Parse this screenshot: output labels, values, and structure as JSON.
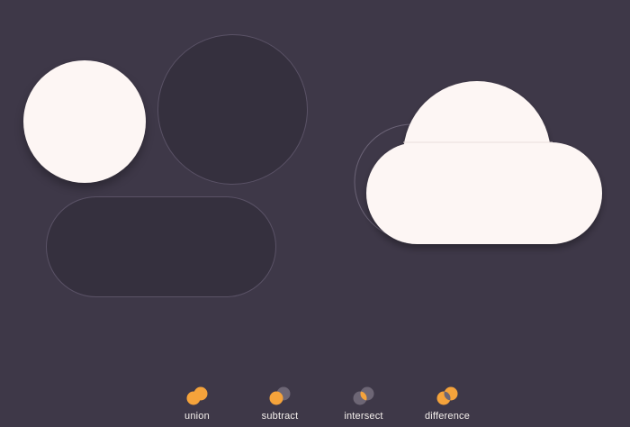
{
  "colors": {
    "background": "#3e3848",
    "shape_light": "#fdf6f4",
    "shape_dark": "#35303e",
    "outline": "#5a5266",
    "accent_orange": "#f5a33b",
    "icon_gray": "#6d6675",
    "label": "#f4efec"
  },
  "operations": [
    {
      "id": "union",
      "label": "union",
      "icon": "union-icon"
    },
    {
      "id": "subtract",
      "label": "subtract",
      "icon": "subtract-icon"
    },
    {
      "id": "intersect",
      "label": "intersect",
      "icon": "intersect-icon"
    },
    {
      "id": "difference",
      "label": "difference",
      "icon": "difference-icon"
    }
  ]
}
